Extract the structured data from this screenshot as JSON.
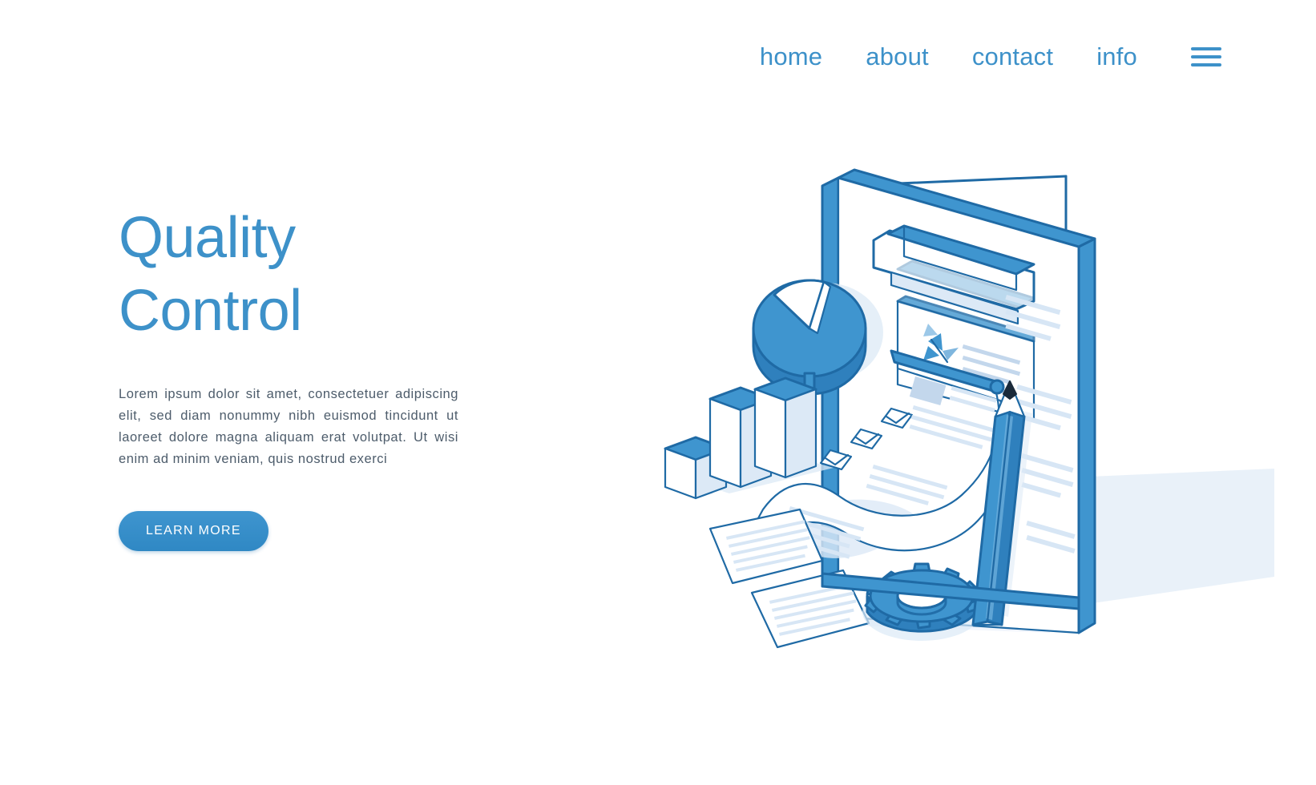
{
  "nav": {
    "items": [
      {
        "label": "home",
        "name": "nav-link-home"
      },
      {
        "label": "about",
        "name": "nav-link-about"
      },
      {
        "label": "contact",
        "name": "nav-link-contact"
      },
      {
        "label": "info",
        "name": "nav-link-info"
      }
    ],
    "menu_icon": "hamburger-menu-icon"
  },
  "hero": {
    "headline_line1": "Quality",
    "headline_line2": "Control",
    "paragraph": "Lorem ipsum dolor sit amet, consectetuer adipiscing elit, sed diam nonummy nibh euismod tincidunt ut laoreet dolore magna aliquam erat volutpat. Ut wisi enim ad minim veniam, quis nostrud exerci",
    "cta_label": "LEARN MORE"
  },
  "colors": {
    "accent_blue": "#3d91c9",
    "deep_blue": "#1f6aa5",
    "mid_blue": "#3f95cf",
    "pale_blue": "#dce9f6",
    "faint_blue": "#eef4fb",
    "text_gray": "#4d5c6b",
    "white": "#ffffff",
    "pencil_tip": "#1a2a3a"
  },
  "illustration": {
    "name": "quality-control-isometric-illustration",
    "elements": [
      "clipboard-board",
      "clipboard-clip",
      "pie-chart-3d",
      "inner-card-pinwheel-chart",
      "checklist-scroll",
      "checkbox-checkmarks",
      "bar-chart-blocks",
      "loose-paper-sheets",
      "gear-cog",
      "pencil",
      "ground-shadow"
    ],
    "checkbox_count": 3,
    "bar_count": 3,
    "gear_teeth": 12,
    "loose_paper_count": 2
  }
}
